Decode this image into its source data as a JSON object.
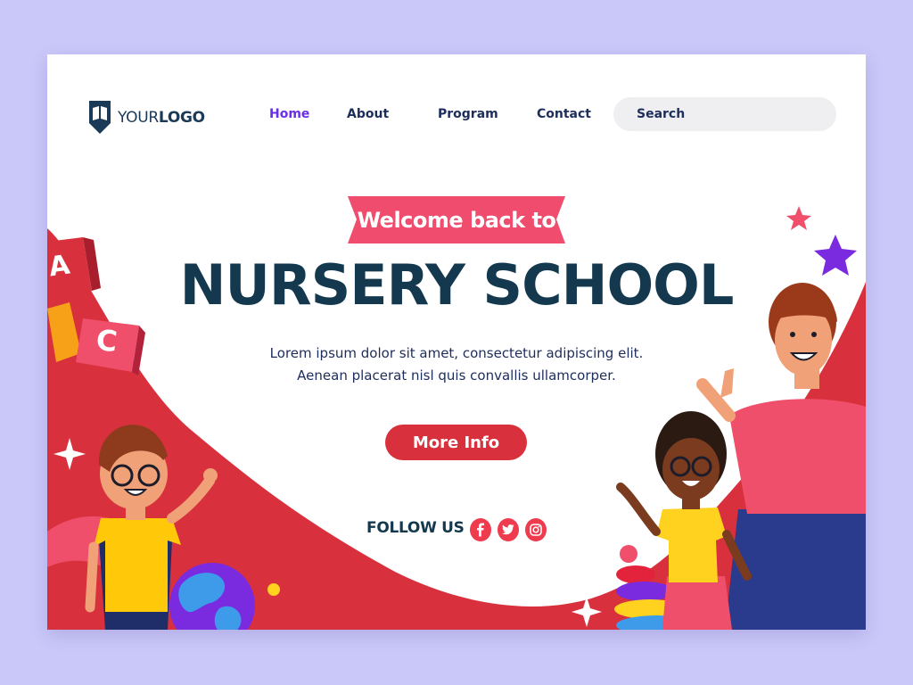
{
  "logo": {
    "prefix": "YOUR",
    "suffix": "LOGO",
    "icon": "book-shield-icon"
  },
  "nav": {
    "items": [
      {
        "label": "Home",
        "active": true
      },
      {
        "label": "About",
        "active": false
      },
      {
        "label": "Program",
        "active": false
      },
      {
        "label": "Contact",
        "active": false
      }
    ]
  },
  "search": {
    "label": "Search"
  },
  "hero": {
    "ribbon": "Welcome back to",
    "title": "NURSERY SCHOOL",
    "description_line1": "Lorem ipsum dolor sit amet, consectetur adipiscing elit.",
    "description_line2": "Aenean placerat nisl quis convallis ullamcorper.",
    "cta": "More Info"
  },
  "social": {
    "label": "FOLLOW US",
    "icons": [
      "facebook-icon",
      "twitter-icon",
      "instagram-icon"
    ]
  },
  "decor": {
    "blocks": [
      "A",
      "C"
    ]
  },
  "colors": {
    "page_bg": "#cac8f9",
    "accent_red": "#d8313d",
    "ribbon_pink": "#f04c6d",
    "title_navy": "#14394f",
    "nav_active": "#6a2ee8",
    "social_pink": "#ee3b4e"
  }
}
